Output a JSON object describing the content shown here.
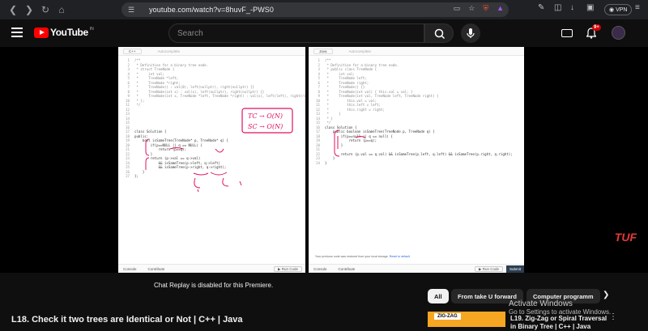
{
  "browser": {
    "url": "youtube.com/watch?v=8huvF_-PWS0",
    "vpn_label": "VPN"
  },
  "youtube": {
    "logo_text": "YouTube",
    "country_code": "IN",
    "search_placeholder": "Search",
    "notification_count": "9+"
  },
  "left_editor": {
    "language": "C++",
    "autocomplete": "Autocomplete",
    "code_lines": [
      {
        "n": "1",
        "t": "/**"
      },
      {
        "n": "2",
        "t": " * Definition for a binary tree node."
      },
      {
        "n": "3",
        "t": " * struct TreeNode {"
      },
      {
        "n": "4",
        "t": " *     int val;"
      },
      {
        "n": "5",
        "t": " *     TreeNode *left;"
      },
      {
        "n": "6",
        "t": " *     TreeNode *right;"
      },
      {
        "n": "7",
        "t": " *     TreeNode() : val(0), left(nullptr), right(nullptr) {}"
      },
      {
        "n": "8",
        "t": " *     TreeNode(int x) : val(x), left(nullptr), right(nullptr) {}"
      },
      {
        "n": "9",
        "t": " *     TreeNode(int x, TreeNode *left, TreeNode *right) : val(x), left(left), right(right) {}"
      },
      {
        "n": "10",
        "t": " * };"
      },
      {
        "n": "11",
        "t": " */"
      },
      {
        "n": "12",
        "t": ""
      },
      {
        "n": "13",
        "t": ""
      },
      {
        "n": "14",
        "t": ""
      },
      {
        "n": "15",
        "t": ""
      },
      {
        "n": "16",
        "t": ""
      },
      {
        "n": "17",
        "t": "class Solution {"
      },
      {
        "n": "18",
        "t": "public:"
      },
      {
        "n": "19",
        "t": "    bool isSameTree(TreeNode* p, TreeNode* q) {"
      },
      {
        "n": "20",
        "t": "        if(p==NULL || q == NULL) {"
      },
      {
        "n": "21",
        "t": "            return (p==q);"
      },
      {
        "n": "22",
        "t": "        }"
      },
      {
        "n": "23",
        "t": "        return (p->val == q->val)"
      },
      {
        "n": "24",
        "t": "            && isSameTree(p->left, q->left)"
      },
      {
        "n": "25",
        "t": "            && isSameTree(p->right, q->right);"
      },
      {
        "n": "26",
        "t": "    }"
      },
      {
        "n": "27",
        "t": "};"
      }
    ],
    "annotation_line1": "TC → O(N)",
    "annotation_line2": "SC → O(N)",
    "console": "Console",
    "contribute": "Contribute",
    "run_code": "Run Code"
  },
  "right_editor": {
    "language": "Java",
    "autocomplete": "Autocomplete",
    "code_lines": [
      {
        "n": "1",
        "t": "/**"
      },
      {
        "n": "2",
        "t": " * Definition for a binary tree node."
      },
      {
        "n": "3",
        "t": " * public class TreeNode {"
      },
      {
        "n": "4",
        "t": " *     int val;"
      },
      {
        "n": "5",
        "t": " *     TreeNode left;"
      },
      {
        "n": "6",
        "t": " *     TreeNode right;"
      },
      {
        "n": "7",
        "t": " *     TreeNode() {}"
      },
      {
        "n": "8",
        "t": " *     TreeNode(int val) { this.val = val; }"
      },
      {
        "n": "9",
        "t": " *     TreeNode(int val, TreeNode left, TreeNode right) {"
      },
      {
        "n": "10",
        "t": " *         this.val = val;"
      },
      {
        "n": "11",
        "t": " *         this.left = left;"
      },
      {
        "n": "12",
        "t": " *         this.right = right;"
      },
      {
        "n": "13",
        "t": " *     }"
      },
      {
        "n": "14",
        "t": " * }"
      },
      {
        "n": "15",
        "t": " */"
      },
      {
        "n": "16",
        "t": "class Solution {"
      },
      {
        "n": "17",
        "t": "    public boolean isSameTree(TreeNode p, TreeNode q) {"
      },
      {
        "n": "18",
        "t": "        if(p==null || q == null) {"
      },
      {
        "n": "19",
        "t": "            return (p==q);"
      },
      {
        "n": "20",
        "t": "        }"
      },
      {
        "n": "21",
        "t": ""
      },
      {
        "n": "22",
        "t": "        return (p.val == q.val) && isSameTree(p.left, q.left) && isSameTree(p.right, q.right);"
      },
      {
        "n": "23",
        "t": "    }"
      },
      {
        "n": "24",
        "t": "}"
      }
    ],
    "restore_note": "Your previous code was restored from your local storage.",
    "reset_link": "Reset to default",
    "console": "Console",
    "contribute": "Contribute",
    "run_code": "Run Code",
    "submit": "Submit"
  },
  "channel_watermark": "TUF",
  "below_player": {
    "chat_replay": "Chat Replay is disabled for this Premiere.",
    "video_title": "L18. Check it two trees are Identical or Not | C++ | Java",
    "chips": [
      "All",
      "From take U forward",
      "Computer programm"
    ],
    "activate_line1": "Activate Windows",
    "activate_line2": "Go to Settings to activate Windows.",
    "related_title_line1": "L19. Zig-Zag or Spiral Traversal",
    "related_title_line2": "in Binary Tree | C++ | Java",
    "related_thumb_label": "ZIG-ZAG"
  },
  "colors": {
    "youtube_red": "#ff0000",
    "annotation_pink": "#e0115f",
    "submit_dark": "#2c3e50"
  }
}
